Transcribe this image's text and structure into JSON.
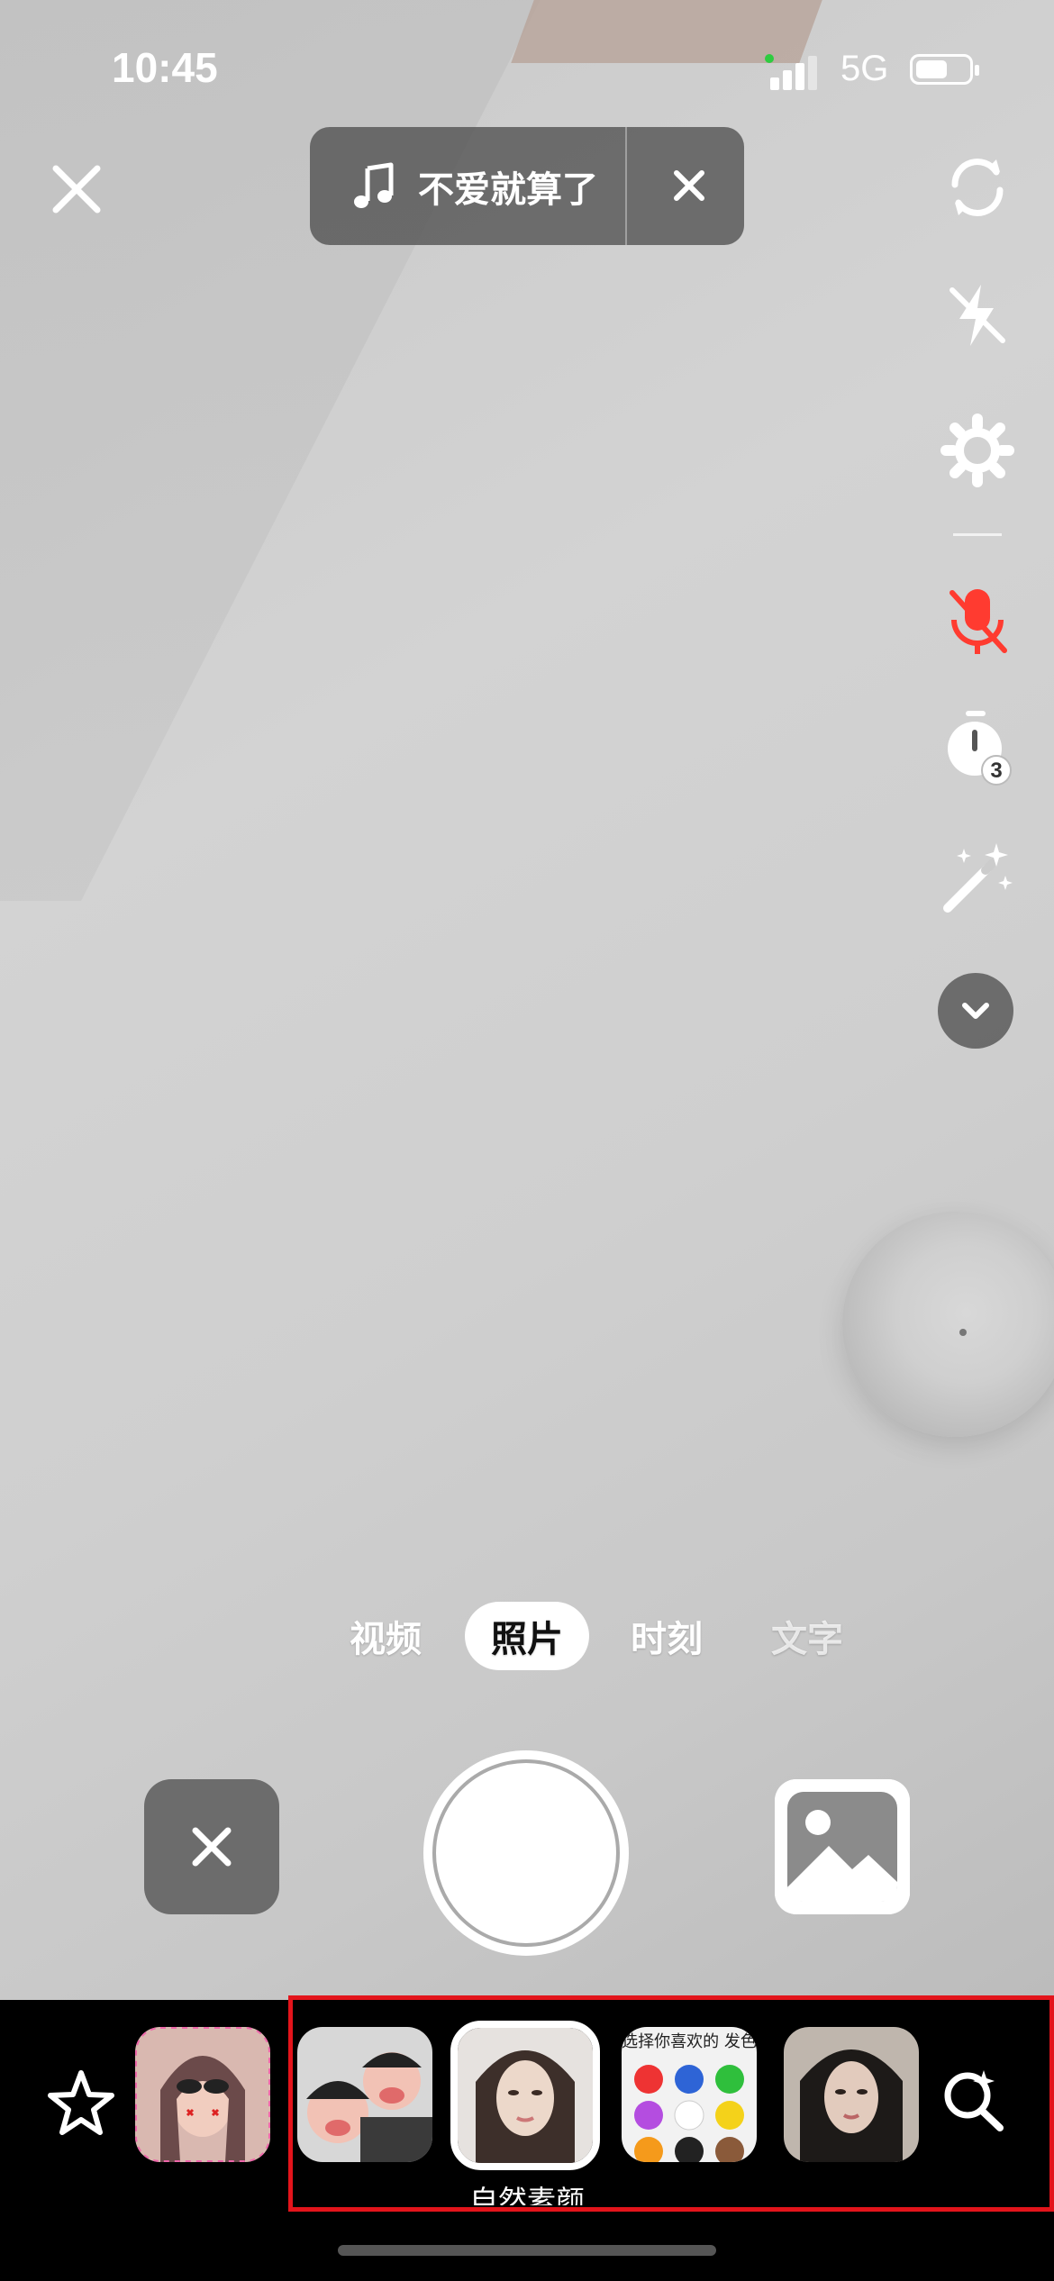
{
  "status_bar": {
    "time": "10:45",
    "network": "5G"
  },
  "music": {
    "title": "不爱就算了"
  },
  "modes": [
    {
      "label": "视频",
      "state": "normal"
    },
    {
      "label": "照片",
      "state": "active"
    },
    {
      "label": "时刻",
      "state": "normal"
    },
    {
      "label": "文字",
      "state": "dim"
    }
  ],
  "filters": {
    "selected_label": "自然素颜",
    "items": [
      {
        "name": "filter-cartoon-girl",
        "colors": [
          "#e7b8b8",
          "#6b4a4a"
        ]
      },
      {
        "name": "filter-couple-cartoon",
        "colors": [
          "#f2c2b5",
          "#3a3a3a"
        ]
      },
      {
        "name": "filter-natural",
        "colors": [
          "#e9d6c8",
          "#3d2f2a"
        ]
      },
      {
        "name": "filter-color-pick",
        "colors": [
          "#f0f0f0",
          "#e33"
        ]
      },
      {
        "name": "filter-portrait",
        "colors": [
          "#d9c2b4",
          "#1d1a18"
        ]
      }
    ],
    "picker_text": "选择你喜欢的 发色"
  },
  "icons": {
    "close": "close-icon",
    "music": "music-note-icon",
    "flip": "flip-camera-icon",
    "flash_off": "flash-off-icon",
    "settings": "gear-icon",
    "mic_off": "mic-off-icon",
    "timer": "timer-icon",
    "beauty": "magic-wand-icon",
    "more": "chevron-down-icon",
    "favorites": "star-icon",
    "search_effects": "search-sparkle-icon",
    "gallery": "image-icon"
  },
  "timer_value": "3",
  "accent_colors": {
    "mic_off": "#ff3b30",
    "highlight": "#e3141b"
  }
}
